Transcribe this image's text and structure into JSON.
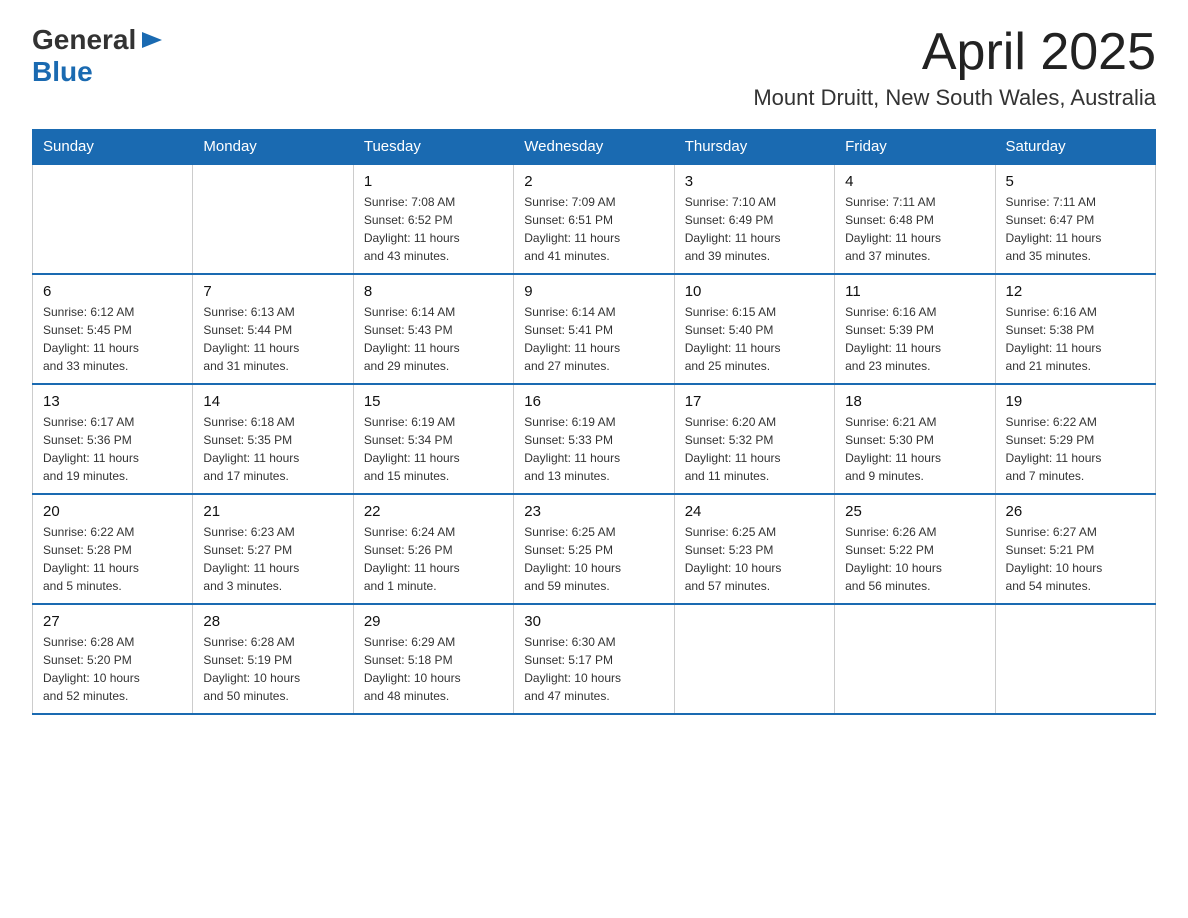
{
  "logo": {
    "general": "General",
    "blue": "Blue"
  },
  "title": {
    "month_year": "April 2025",
    "location": "Mount Druitt, New South Wales, Australia"
  },
  "days_of_week": [
    "Sunday",
    "Monday",
    "Tuesday",
    "Wednesday",
    "Thursday",
    "Friday",
    "Saturday"
  ],
  "weeks": [
    [
      {
        "day": "",
        "info": ""
      },
      {
        "day": "",
        "info": ""
      },
      {
        "day": "1",
        "info": "Sunrise: 7:08 AM\nSunset: 6:52 PM\nDaylight: 11 hours\nand 43 minutes."
      },
      {
        "day": "2",
        "info": "Sunrise: 7:09 AM\nSunset: 6:51 PM\nDaylight: 11 hours\nand 41 minutes."
      },
      {
        "day": "3",
        "info": "Sunrise: 7:10 AM\nSunset: 6:49 PM\nDaylight: 11 hours\nand 39 minutes."
      },
      {
        "day": "4",
        "info": "Sunrise: 7:11 AM\nSunset: 6:48 PM\nDaylight: 11 hours\nand 37 minutes."
      },
      {
        "day": "5",
        "info": "Sunrise: 7:11 AM\nSunset: 6:47 PM\nDaylight: 11 hours\nand 35 minutes."
      }
    ],
    [
      {
        "day": "6",
        "info": "Sunrise: 6:12 AM\nSunset: 5:45 PM\nDaylight: 11 hours\nand 33 minutes."
      },
      {
        "day": "7",
        "info": "Sunrise: 6:13 AM\nSunset: 5:44 PM\nDaylight: 11 hours\nand 31 minutes."
      },
      {
        "day": "8",
        "info": "Sunrise: 6:14 AM\nSunset: 5:43 PM\nDaylight: 11 hours\nand 29 minutes."
      },
      {
        "day": "9",
        "info": "Sunrise: 6:14 AM\nSunset: 5:41 PM\nDaylight: 11 hours\nand 27 minutes."
      },
      {
        "day": "10",
        "info": "Sunrise: 6:15 AM\nSunset: 5:40 PM\nDaylight: 11 hours\nand 25 minutes."
      },
      {
        "day": "11",
        "info": "Sunrise: 6:16 AM\nSunset: 5:39 PM\nDaylight: 11 hours\nand 23 minutes."
      },
      {
        "day": "12",
        "info": "Sunrise: 6:16 AM\nSunset: 5:38 PM\nDaylight: 11 hours\nand 21 minutes."
      }
    ],
    [
      {
        "day": "13",
        "info": "Sunrise: 6:17 AM\nSunset: 5:36 PM\nDaylight: 11 hours\nand 19 minutes."
      },
      {
        "day": "14",
        "info": "Sunrise: 6:18 AM\nSunset: 5:35 PM\nDaylight: 11 hours\nand 17 minutes."
      },
      {
        "day": "15",
        "info": "Sunrise: 6:19 AM\nSunset: 5:34 PM\nDaylight: 11 hours\nand 15 minutes."
      },
      {
        "day": "16",
        "info": "Sunrise: 6:19 AM\nSunset: 5:33 PM\nDaylight: 11 hours\nand 13 minutes."
      },
      {
        "day": "17",
        "info": "Sunrise: 6:20 AM\nSunset: 5:32 PM\nDaylight: 11 hours\nand 11 minutes."
      },
      {
        "day": "18",
        "info": "Sunrise: 6:21 AM\nSunset: 5:30 PM\nDaylight: 11 hours\nand 9 minutes."
      },
      {
        "day": "19",
        "info": "Sunrise: 6:22 AM\nSunset: 5:29 PM\nDaylight: 11 hours\nand 7 minutes."
      }
    ],
    [
      {
        "day": "20",
        "info": "Sunrise: 6:22 AM\nSunset: 5:28 PM\nDaylight: 11 hours\nand 5 minutes."
      },
      {
        "day": "21",
        "info": "Sunrise: 6:23 AM\nSunset: 5:27 PM\nDaylight: 11 hours\nand 3 minutes."
      },
      {
        "day": "22",
        "info": "Sunrise: 6:24 AM\nSunset: 5:26 PM\nDaylight: 11 hours\nand 1 minute."
      },
      {
        "day": "23",
        "info": "Sunrise: 6:25 AM\nSunset: 5:25 PM\nDaylight: 10 hours\nand 59 minutes."
      },
      {
        "day": "24",
        "info": "Sunrise: 6:25 AM\nSunset: 5:23 PM\nDaylight: 10 hours\nand 57 minutes."
      },
      {
        "day": "25",
        "info": "Sunrise: 6:26 AM\nSunset: 5:22 PM\nDaylight: 10 hours\nand 56 minutes."
      },
      {
        "day": "26",
        "info": "Sunrise: 6:27 AM\nSunset: 5:21 PM\nDaylight: 10 hours\nand 54 minutes."
      }
    ],
    [
      {
        "day": "27",
        "info": "Sunrise: 6:28 AM\nSunset: 5:20 PM\nDaylight: 10 hours\nand 52 minutes."
      },
      {
        "day": "28",
        "info": "Sunrise: 6:28 AM\nSunset: 5:19 PM\nDaylight: 10 hours\nand 50 minutes."
      },
      {
        "day": "29",
        "info": "Sunrise: 6:29 AM\nSunset: 5:18 PM\nDaylight: 10 hours\nand 48 minutes."
      },
      {
        "day": "30",
        "info": "Sunrise: 6:30 AM\nSunset: 5:17 PM\nDaylight: 10 hours\nand 47 minutes."
      },
      {
        "day": "",
        "info": ""
      },
      {
        "day": "",
        "info": ""
      },
      {
        "day": "",
        "info": ""
      }
    ]
  ]
}
